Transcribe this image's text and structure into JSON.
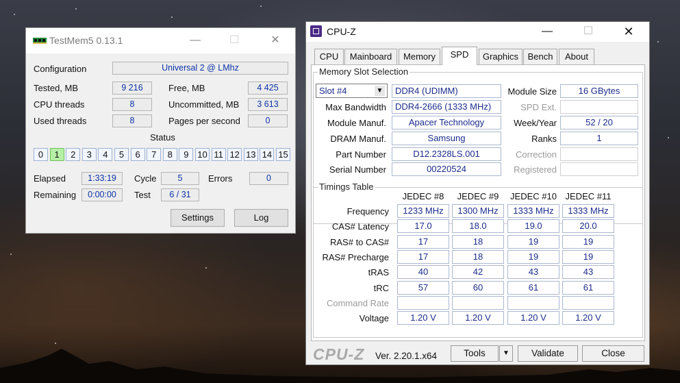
{
  "testmem": {
    "title": "TestMem5  0.13.1",
    "controls": [
      "—",
      "☐",
      "✕"
    ],
    "configuration_label": "Configuration",
    "configuration_value": "Universal 2 @ LMhz",
    "tested_label": "Tested, MB",
    "tested_value": "9 216",
    "free_label": "Free, MB",
    "free_value": "4 425",
    "cpu_threads_label": "CPU threads",
    "cpu_threads_value": "8",
    "uncommitted_label": "Uncommitted, MB",
    "uncommitted_value": "3 613",
    "used_threads_label": "Used threads",
    "used_threads_value": "8",
    "pages_label": "Pages per second",
    "pages_value": "0",
    "status_label": "Status",
    "status_numbers": [
      "0",
      "1",
      "2",
      "3",
      "4",
      "5",
      "6",
      "7",
      "8",
      "9",
      "10",
      "11",
      "12",
      "13",
      "14",
      "15"
    ],
    "status_active_index": 1,
    "elapsed_label": "Elapsed",
    "elapsed_value": "1:33:19",
    "cycle_label": "Cycle",
    "cycle_value": "5",
    "errors_label": "Errors",
    "errors_value": "0",
    "remaining_label": "Remaining",
    "remaining_value": "0:00:00",
    "test_label": "Test",
    "test_value": "6 / 31",
    "settings_button": "Settings",
    "log_button": "Log"
  },
  "cpuz": {
    "title": "CPU-Z",
    "controls": [
      "—",
      "☐",
      "✕"
    ],
    "tabs": [
      "CPU",
      "Mainboard",
      "Memory",
      "SPD",
      "Graphics",
      "Bench",
      "About"
    ],
    "selected_tab": "SPD",
    "slot_group_title": "Memory Slot Selection",
    "slot_select": "Slot #4",
    "memory_type": "DDR4 (UDIMM)",
    "module_size_label": "Module Size",
    "module_size": "16 GBytes",
    "max_bw_label": "Max Bandwidth",
    "max_bw": "DDR4-2666 (1333 MHz)",
    "spd_ext_label": "SPD Ext.",
    "spd_ext": "",
    "manuf_label": "Module Manuf.",
    "manuf": "Apacer Technology",
    "week_year_label": "Week/Year",
    "week_year": "52 / 20",
    "dram_manuf_label": "DRAM Manuf.",
    "dram_manuf": "Samsung",
    "ranks_label": "Ranks",
    "ranks": "1",
    "part_label": "Part Number",
    "part": "D12.2328LS.001",
    "correction_label": "Correction",
    "correction": "",
    "serial_label": "Serial Number",
    "serial": "00220524",
    "registered_label": "Registered",
    "registered": "",
    "timings_group_title": "Timings Table",
    "timing_headers": [
      "JEDEC #8",
      "JEDEC #9",
      "JEDEC #10",
      "JEDEC #11"
    ],
    "timing_rows": [
      {
        "label": "Frequency",
        "values": [
          "1233 MHz",
          "1300 MHz",
          "1333 MHz",
          "1333 MHz"
        ]
      },
      {
        "label": "CAS# Latency",
        "values": [
          "17.0",
          "18.0",
          "19.0",
          "20.0"
        ]
      },
      {
        "label": "RAS# to CAS#",
        "values": [
          "17",
          "18",
          "19",
          "19"
        ]
      },
      {
        "label": "RAS# Precharge",
        "values": [
          "17",
          "18",
          "19",
          "19"
        ]
      },
      {
        "label": "tRAS",
        "values": [
          "40",
          "42",
          "43",
          "43"
        ]
      },
      {
        "label": "tRC",
        "values": [
          "57",
          "60",
          "61",
          "61"
        ]
      },
      {
        "label": "Command Rate",
        "values": [
          "",
          "",
          "",
          ""
        ]
      },
      {
        "label": "Voltage",
        "values": [
          "1.20 V",
          "1.20 V",
          "1.20 V",
          "1.20 V"
        ]
      }
    ],
    "logo": "CPU-Z",
    "version": "Ver. 2.20.1.x64",
    "tools_button": "Tools",
    "tools_arrow": "▼",
    "validate_button": "Validate",
    "close_button": "Close"
  }
}
